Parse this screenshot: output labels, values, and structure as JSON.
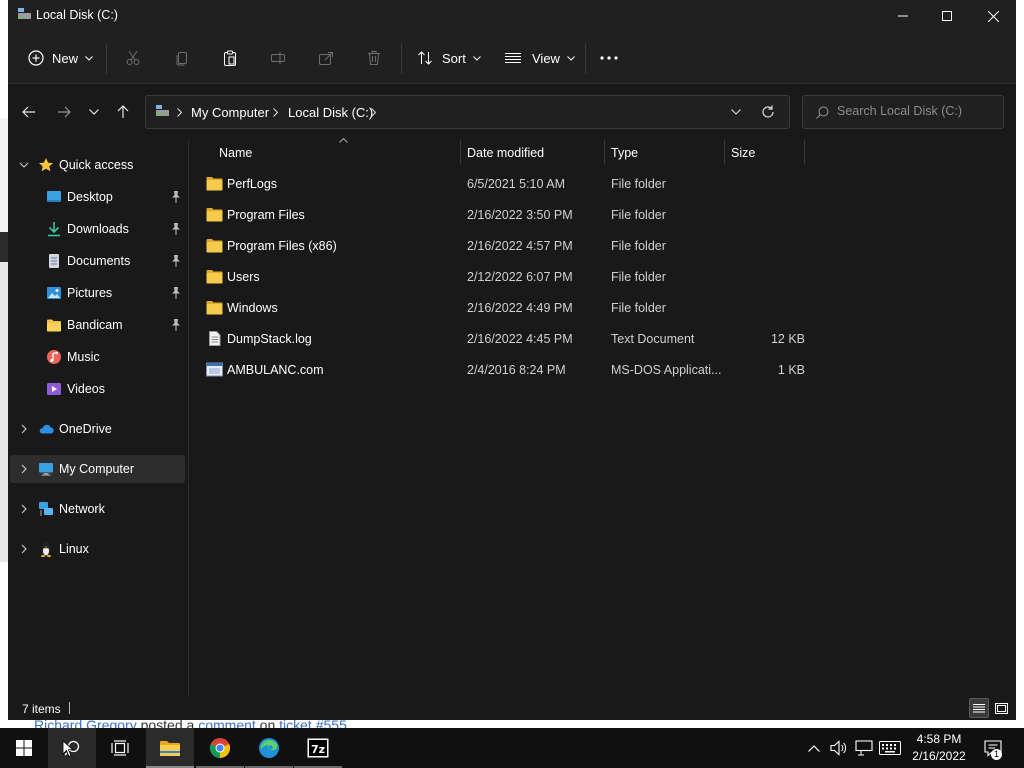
{
  "window": {
    "title": "Local Disk (C:)"
  },
  "commandbar": {
    "new_label": "New",
    "sort_label": "Sort",
    "view_label": "View"
  },
  "address": {
    "crumbs": [
      "My Computer",
      "Local Disk (C:)"
    ]
  },
  "search": {
    "placeholder": "Search Local Disk (C:)"
  },
  "sidebar": {
    "quick_access": "Quick access",
    "items": [
      {
        "label": "Desktop",
        "icon": "desktop-icon",
        "pinned": true
      },
      {
        "label": "Downloads",
        "icon": "downloads-icon",
        "pinned": true
      },
      {
        "label": "Documents",
        "icon": "documents-icon",
        "pinned": true
      },
      {
        "label": "Pictures",
        "icon": "pictures-icon",
        "pinned": true
      },
      {
        "label": "Bandicam",
        "icon": "folder-icon",
        "pinned": true
      },
      {
        "label": "Music",
        "icon": "music-icon",
        "pinned": false
      },
      {
        "label": "Videos",
        "icon": "videos-icon",
        "pinned": false
      }
    ],
    "onedrive": "OneDrive",
    "my_computer": "My Computer",
    "network": "Network",
    "linux": "Linux"
  },
  "columns": {
    "name": "Name",
    "date": "Date modified",
    "type": "Type",
    "size": "Size"
  },
  "files": [
    {
      "name": "PerfLogs",
      "date": "6/5/2021 5:10 AM",
      "type": "File folder",
      "size": "",
      "icon": "folder-icon"
    },
    {
      "name": "Program Files",
      "date": "2/16/2022 3:50 PM",
      "type": "File folder",
      "size": "",
      "icon": "folder-icon"
    },
    {
      "name": "Program Files (x86)",
      "date": "2/16/2022 4:57 PM",
      "type": "File folder",
      "size": "",
      "icon": "folder-icon"
    },
    {
      "name": "Users",
      "date": "2/12/2022 6:07 PM",
      "type": "File folder",
      "size": "",
      "icon": "folder-icon"
    },
    {
      "name": "Windows",
      "date": "2/16/2022 4:49 PM",
      "type": "File folder",
      "size": "",
      "icon": "folder-icon"
    },
    {
      "name": "DumpStack.log",
      "date": "2/16/2022 4:45 PM",
      "type": "Text Document",
      "size": "12 KB",
      "icon": "text-file-icon"
    },
    {
      "name": "AMBULANC.com",
      "date": "2/4/2016 8:24 PM",
      "type": "MS-DOS Applicati...",
      "size": "1 KB",
      "icon": "app-file-icon"
    }
  ],
  "status": {
    "items_count": "7 items"
  },
  "background": {
    "name": "Richard Gregory",
    "text1": " posted a ",
    "link1": "comment",
    "text2": " on ",
    "link2": "ticket #555"
  },
  "taskbar": {
    "time": "4:58 PM",
    "date": "2/16/2022",
    "notification_count": "1"
  },
  "colors": {
    "window_bg": "#191919",
    "titlebar_bg": "#202020",
    "folder": "#f3c342",
    "accent": "#4aa3e6"
  }
}
